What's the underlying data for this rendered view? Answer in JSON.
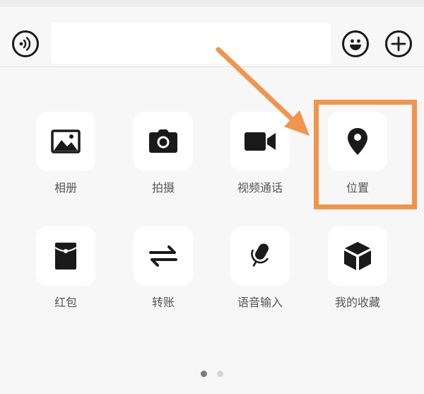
{
  "input_bar": {
    "voice_icon": "voice-icon",
    "emoji_icon": "emoji-icon",
    "plus_icon": "plus-icon",
    "text_value": ""
  },
  "panel": {
    "items": [
      {
        "label": "相册",
        "icon": "photo-album-icon"
      },
      {
        "label": "拍摄",
        "icon": "camera-icon"
      },
      {
        "label": "视频通话",
        "icon": "video-call-icon"
      },
      {
        "label": "位置",
        "icon": "location-pin-icon"
      },
      {
        "label": "红包",
        "icon": "red-packet-icon"
      },
      {
        "label": "转账",
        "icon": "transfer-icon"
      },
      {
        "label": "语音输入",
        "icon": "microphone-icon"
      },
      {
        "label": "我的收藏",
        "icon": "favorites-cube-icon"
      }
    ],
    "page_indicator": {
      "current": 1,
      "total": 2
    }
  },
  "annotation": {
    "color": "#f0954b",
    "highlighted_item": "位置"
  }
}
